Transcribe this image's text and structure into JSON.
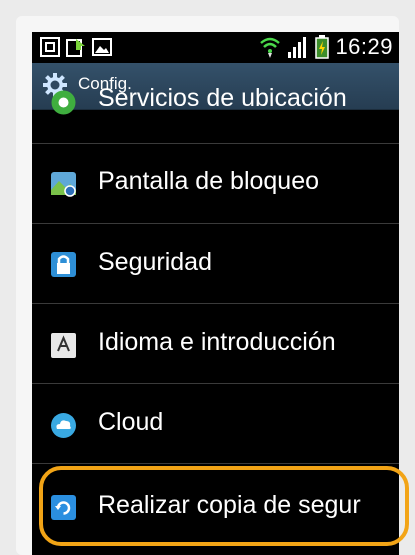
{
  "status_bar": {
    "time": "16:29",
    "left_icons": [
      "screenshot-icon",
      "download-icon",
      "gallery-icon"
    ],
    "right_icons": [
      "wifi-icon",
      "signal-icon",
      "battery-charging-icon"
    ]
  },
  "title_bar": {
    "title": "Config."
  },
  "settings_list": [
    {
      "label": "Servicios de ubicación",
      "icon": "location-icon",
      "partially_visible": true
    },
    {
      "label": "Pantalla de bloqueo",
      "icon": "lock-screen-icon"
    },
    {
      "label": "Seguridad",
      "icon": "security-icon"
    },
    {
      "label": "Idioma e introducción",
      "icon": "language-icon"
    },
    {
      "label": "Cloud",
      "icon": "cloud-icon"
    },
    {
      "label": "Realizar copia de segur",
      "icon": "backup-icon",
      "highlighted": true
    }
  ],
  "colors": {
    "highlight": "#f2a416",
    "title_bar": "#2e4760"
  }
}
